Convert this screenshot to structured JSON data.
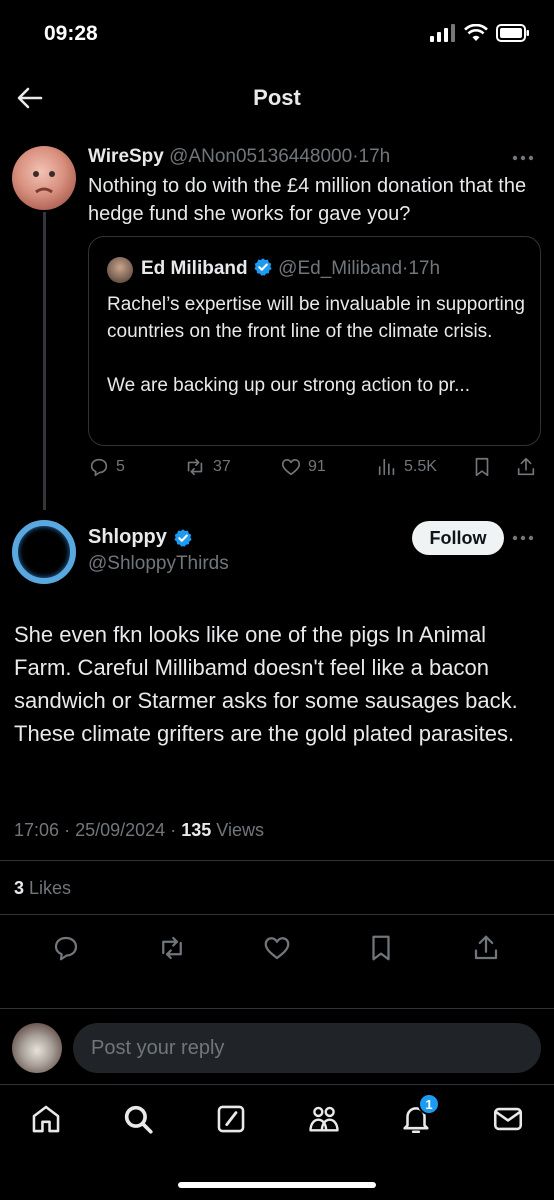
{
  "status_bar": {
    "time": "09:28"
  },
  "header": {
    "title": "Post"
  },
  "parent_post": {
    "name": "WireSpy",
    "handle": "@ANon05136448000",
    "time": "17h",
    "text": "Nothing to do with the £4 million donation that the hedge fund she works for gave you?",
    "quote": {
      "name": "Ed Miliband",
      "handle": "@Ed_Miliband",
      "time": "17h",
      "text": "Rachel’s expertise will be invaluable in supporting countries on the front line of the climate crisis.\n\nWe are backing up our strong action to pr..."
    },
    "stats": {
      "replies": "5",
      "reposts": "37",
      "likes": "91",
      "views": "5.5K"
    }
  },
  "reply_post": {
    "name": "Shloppy",
    "handle": "@ShloppyThirds",
    "follow_label": "Follow",
    "text": "She even fkn looks like one of the pigs In Animal Farm. Careful Millibamd doesn't feel like a bacon sandwich or Starmer asks for some sausages back. These climate grifters are the gold plated parasites.",
    "time": "17:06",
    "date": "25/09/2024",
    "views_count": "135",
    "views_label": "Views",
    "likes_count": "3",
    "likes_label": "Likes"
  },
  "reply_bar": {
    "placeholder": "Post your reply"
  },
  "tabbar": {
    "notifications_badge": "1"
  },
  "colors": {
    "accent": "#1d9bf0",
    "verified": "#1d9bf0",
    "muted": "#71767b",
    "text": "#e7e9ea",
    "background": "#000000"
  },
  "icons": [
    "back-arrow-icon",
    "more-icon",
    "reply-icon",
    "repost-icon",
    "like-icon",
    "views-icon",
    "bookmark-icon",
    "share-icon",
    "verified-icon",
    "home-icon",
    "search-icon",
    "compose-icon",
    "communities-icon",
    "notifications-icon",
    "messages-icon"
  ]
}
